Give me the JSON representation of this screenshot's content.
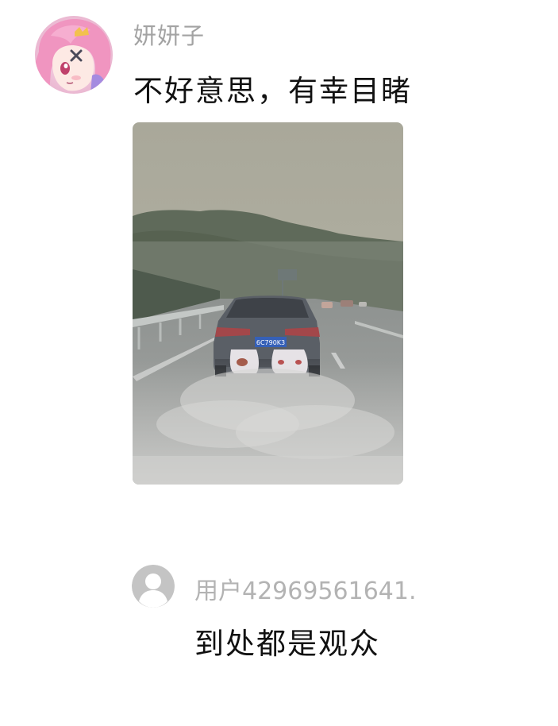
{
  "comments": [
    {
      "username": "妍妍子",
      "text": "不好意思，有幸目睹",
      "avatar_icon": "anime-girl-avatar-icon",
      "has_photo": true,
      "photo": {
        "description_icon": "rainy-highway-car-photo",
        "plate_text": "6C790K3"
      }
    },
    {
      "username": "用户4296956164​1.",
      "text": "到处都是观众",
      "avatar_icon": "default-user-avatar-icon",
      "has_photo": false
    }
  ],
  "colors": {
    "background": "#ffffff",
    "username": "#a3a3a3",
    "text": "#111111",
    "default_avatar_bg": "#c4c4c4"
  }
}
